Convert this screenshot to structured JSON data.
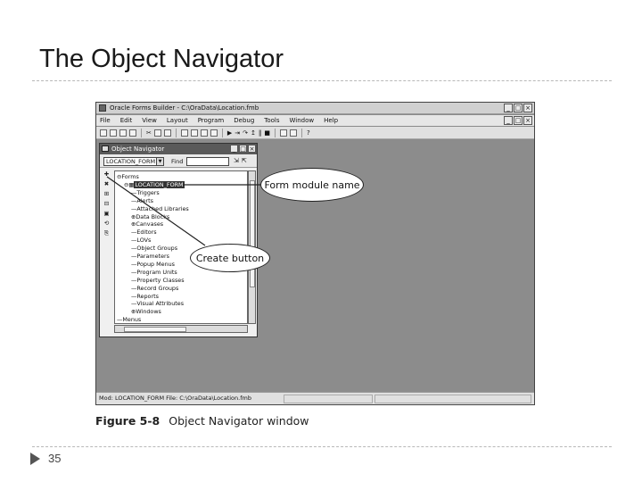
{
  "slide": {
    "title": "The Object Navigator",
    "page_number": "35"
  },
  "window": {
    "title": "Oracle Forms Builder - C:\\OraData\\Location.fmb",
    "controls": [
      "_",
      "□",
      "×"
    ],
    "menu": [
      "File",
      "Edit",
      "View",
      "Layout",
      "Program",
      "Debug",
      "Tools",
      "Window",
      "Help"
    ]
  },
  "navigator": {
    "title": "Object Navigator",
    "combo_value": "LOCATION_FORM",
    "find_label": "Find",
    "tree": [
      {
        "text": "Forms",
        "prefix": "⊖",
        "level": 0
      },
      {
        "text": "LOCATION_FORM",
        "prefix": "⊖▦",
        "level": 1,
        "selected": true
      },
      {
        "text": "Triggers",
        "prefix": "",
        "level": 2
      },
      {
        "text": "Alerts",
        "prefix": "",
        "level": 2
      },
      {
        "text": "Attached Libraries",
        "prefix": "",
        "level": 2
      },
      {
        "text": "Data Blocks",
        "prefix": "⊕",
        "level": 2
      },
      {
        "text": "Canvases",
        "prefix": "⊕",
        "level": 2
      },
      {
        "text": "Editors",
        "prefix": "",
        "level": 2
      },
      {
        "text": "LOVs",
        "prefix": "",
        "level": 2
      },
      {
        "text": "Object Groups",
        "prefix": "",
        "level": 2
      },
      {
        "text": "Parameters",
        "prefix": "",
        "level": 2
      },
      {
        "text": "Popup Menus",
        "prefix": "",
        "level": 2
      },
      {
        "text": "Program Units",
        "prefix": "",
        "level": 2
      },
      {
        "text": "Property Classes",
        "prefix": "",
        "level": 2
      },
      {
        "text": "Record Groups",
        "prefix": "",
        "level": 2
      },
      {
        "text": "Reports",
        "prefix": "",
        "level": 2
      },
      {
        "text": "Visual Attributes",
        "prefix": "",
        "level": 2
      },
      {
        "text": "Windows",
        "prefix": "⊕",
        "level": 2
      },
      {
        "text": "Menus",
        "prefix": "",
        "level": 0
      }
    ]
  },
  "status": {
    "text": "Mod: LOCATION_FORM File: C:\\OraData\\Location.fmb"
  },
  "callouts": {
    "form_module": "Form module name",
    "create_button": "Create button"
  },
  "caption": {
    "figure": "Figure 5-8",
    "text": "Object Navigator window"
  }
}
